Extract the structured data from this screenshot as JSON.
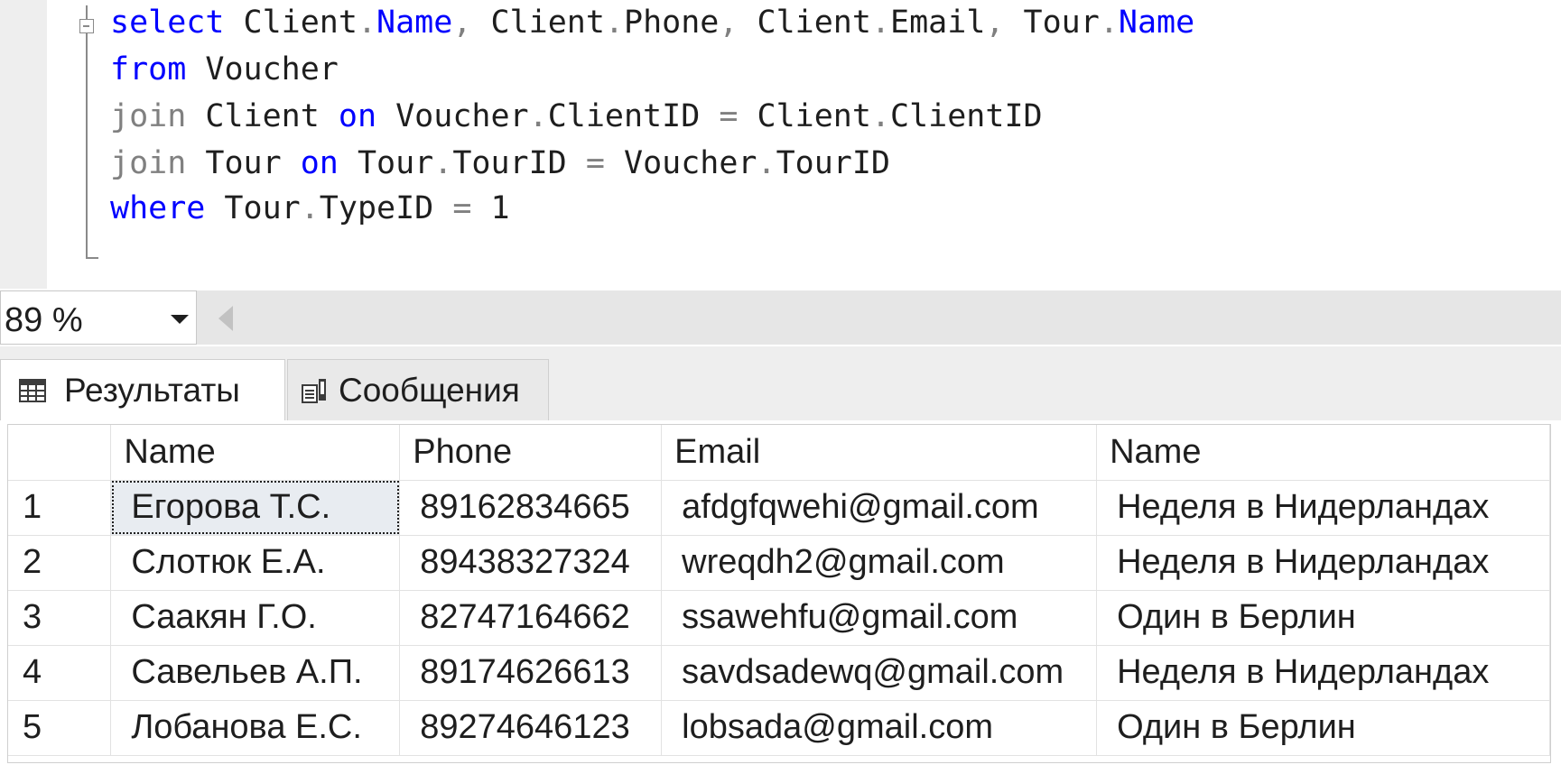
{
  "editor": {
    "lines": [
      [
        {
          "t": "select",
          "c": "kw"
        },
        {
          "t": " Client",
          "c": ""
        },
        {
          "t": ".",
          "c": "op"
        },
        {
          "t": "Name",
          "c": "kw"
        },
        {
          "t": ",",
          "c": "op"
        },
        {
          "t": " Client",
          "c": ""
        },
        {
          "t": ".",
          "c": "op"
        },
        {
          "t": "Phone",
          "c": ""
        },
        {
          "t": ",",
          "c": "op"
        },
        {
          "t": " Client",
          "c": ""
        },
        {
          "t": ".",
          "c": "op"
        },
        {
          "t": "Email",
          "c": ""
        },
        {
          "t": ",",
          "c": "op"
        },
        {
          "t": " Tour",
          "c": ""
        },
        {
          "t": ".",
          "c": "op"
        },
        {
          "t": "Name",
          "c": "kw"
        }
      ],
      [
        {
          "t": "from",
          "c": "kw"
        },
        {
          "t": " Voucher",
          "c": ""
        }
      ],
      [
        {
          "t": "join",
          "c": "op"
        },
        {
          "t": " Client ",
          "c": ""
        },
        {
          "t": "on",
          "c": "kw"
        },
        {
          "t": " Voucher",
          "c": ""
        },
        {
          "t": ".",
          "c": "op"
        },
        {
          "t": "ClientID ",
          "c": ""
        },
        {
          "t": "=",
          "c": "op"
        },
        {
          "t": " Client",
          "c": ""
        },
        {
          "t": ".",
          "c": "op"
        },
        {
          "t": "ClientID",
          "c": ""
        }
      ],
      [
        {
          "t": "join",
          "c": "op"
        },
        {
          "t": " Tour ",
          "c": ""
        },
        {
          "t": "on",
          "c": "kw"
        },
        {
          "t": " Tour",
          "c": ""
        },
        {
          "t": ".",
          "c": "op"
        },
        {
          "t": "TourID ",
          "c": ""
        },
        {
          "t": "=",
          "c": "op"
        },
        {
          "t": " Voucher",
          "c": ""
        },
        {
          "t": ".",
          "c": "op"
        },
        {
          "t": "TourID",
          "c": ""
        }
      ],
      [
        {
          "t": "where",
          "c": "kw"
        },
        {
          "t": " Tour",
          "c": ""
        },
        {
          "t": ".",
          "c": "op"
        },
        {
          "t": "TypeID ",
          "c": ""
        },
        {
          "t": "=",
          "c": "op"
        },
        {
          "t": " 1",
          "c": ""
        }
      ]
    ]
  },
  "zoom": {
    "value": "89 %"
  },
  "tabs": {
    "results_label": "Результаты",
    "messages_label": "Сообщения"
  },
  "grid": {
    "columns": [
      "",
      "Name",
      "Phone",
      "Email",
      "Name"
    ],
    "rows": [
      [
        "1",
        "Егорова Т.С.",
        "89162834665",
        "afdgfqwehi@gmail.com",
        "Неделя в Нидерландах"
      ],
      [
        "2",
        "Слотюк Е.А.",
        "89438327324",
        "wreqdh2@gmail.com",
        "Неделя в Нидерландах"
      ],
      [
        "3",
        "Саакян Г.О.",
        "82747164662",
        "ssawehfu@gmail.com",
        "Один в Берлин"
      ],
      [
        "4",
        "Савельев А.П.",
        "89174626613",
        "savdsadewq@gmail.com",
        "Неделя в Нидерландах"
      ],
      [
        "5",
        "Лобанова Е.С.",
        "89274646123",
        "lobsada@gmail.com",
        "Один в Берлин"
      ]
    ],
    "focused_cell": [
      0,
      1
    ]
  },
  "colors": {
    "keyword": "#0000ff",
    "operator": "#808080",
    "text": "#1e1e1e",
    "gutter": "#eeeeee",
    "selected_cell": "#e8ecf1"
  }
}
